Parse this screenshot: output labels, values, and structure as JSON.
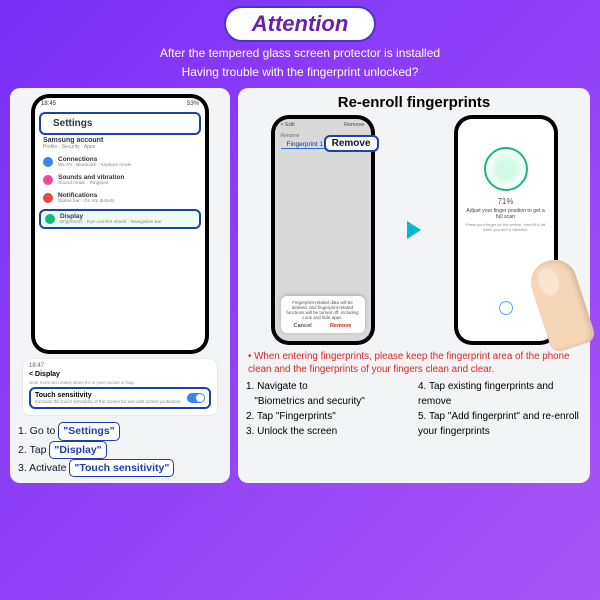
{
  "header": {
    "attention": "Attention",
    "line1": "After the tempered glass screen protector is installed",
    "line2": "Having trouble with the fingerprint unlocked?"
  },
  "left": {
    "status_time": "18:45",
    "status_batt": "53%",
    "settings_title": "Settings",
    "samsung_acct": "Samsung account",
    "samsung_sub": "Profile · Security · Apps",
    "conn_title": "Connections",
    "conn_sub": "WLAN · Bluetooth · Airplane mode",
    "sound_title": "Sounds and vibration",
    "sound_sub": "Sound mode · Ringtone",
    "notif_title": "Notifications",
    "notif_sub": "Status bar · Do not disturb",
    "display_title": "Display",
    "display_sub": "Brightness · Eye comfort shield · Navigation bar",
    "card_time": "18:47",
    "card_back": "Display",
    "card_desc": "Increase the touch sensitivity of the screen for use with screen protectors.",
    "touch_sens": "Touch sensitivity",
    "step1": "1. Go to ",
    "tag_settings": "\"Settings\"",
    "step2": "2. Tap ",
    "tag_display": "\"Display\"",
    "step3": "3. Activate ",
    "tag_touch": "\"Touch sensitivity\""
  },
  "right": {
    "title": "Re-enroll fingerprints",
    "edit": "Edit",
    "remove_hdr": "Remove",
    "rename": "Rename",
    "fp1": "Fingerprint 1",
    "cancel": "Cancel",
    "modal_msg": "Fingerprint-related data will be deleted, and fingerprint-related functions will be turned off, including Lock and hide apps.",
    "remove_btn": "Remove",
    "remove_label": "Remove",
    "pct": "71%",
    "adjust": "Adjust your finger position to get a full scan",
    "press": "Press your finger on the sensor, then lift it off when you feel a vibration.",
    "red_note": "• When entering fingerprints, please keep the fingerprint area of the phone clean and the fingerprints of your fingers clean and clear.",
    "s1": "1. Navigate to",
    "tag_bio": "\"Biometrics and security\"",
    "s2": "2. Tap ",
    "tag_fp": "\"Fingerprints\"",
    "s3": "3. Unlock the screen",
    "s4": "4. Tap existing fingerprints and remove",
    "s5": "5. Tap ",
    "tag_add": "\"Add fingerprint\"",
    "s5b": " and re-enroll your fingerprints"
  }
}
